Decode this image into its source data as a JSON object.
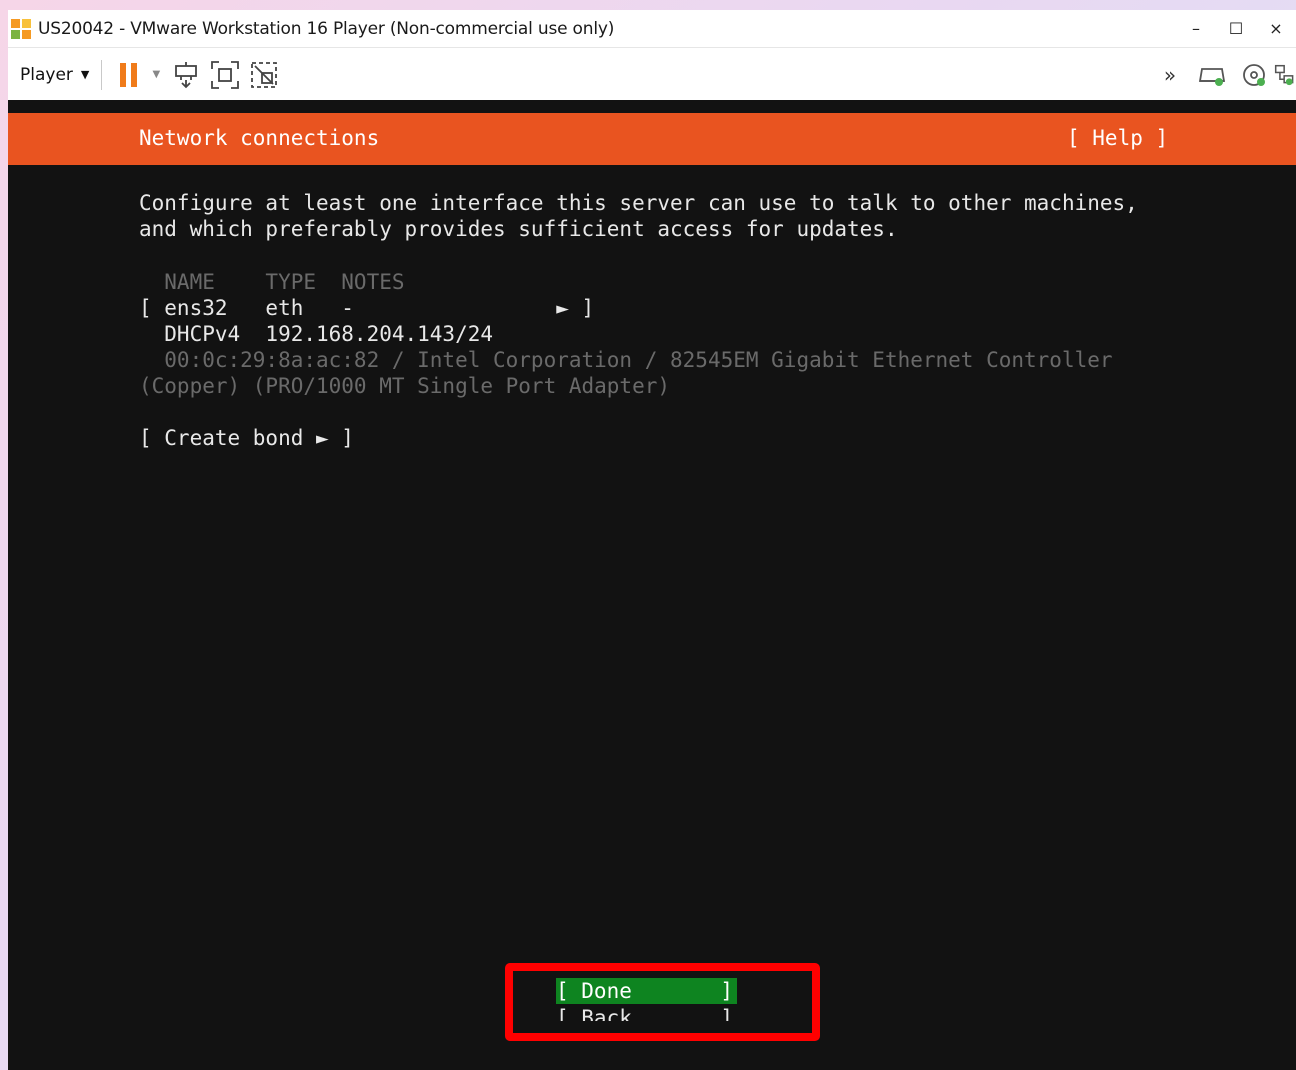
{
  "window": {
    "title": "US20042 - VMware Workstation 16 Player (Non-commercial use only)",
    "controls": {
      "minimize": "–",
      "maximize": "☐",
      "close": "×"
    }
  },
  "toolbar": {
    "player_menu": "Player",
    "icons": [
      "pause-icon",
      "dropdown-arrow-icon",
      "send-ctrl-alt-del-icon",
      "fullscreen-icon",
      "unity-icon",
      "more-icon",
      "removable-device-icon",
      "cd-dvd-icon",
      "network-adapter-icon"
    ]
  },
  "installer": {
    "header_title": "Network connections",
    "help": "[ Help ]",
    "description_line1": "Configure at least one interface this server can use to talk to other machines,",
    "description_line2": "and which preferably provides sufficient access for updates.",
    "table_header": "  NAME    TYPE  NOTES",
    "interface_row": "[ ens32   eth   -                ► ]",
    "dhcp_row": "  DHCPv4  192.168.204.143/24",
    "hw_line1": "  00:0c:29:8a:ac:82 / Intel Corporation / 82545EM Gigabit Ethernet Controller",
    "hw_line2": "(Copper) (PRO/1000 MT Single Port Adapter)",
    "create_bond": "[ Create bond ► ]",
    "done_button": "[ Done       ]",
    "back_button": "[ Back       ]"
  },
  "colors": {
    "header": "#e95420",
    "done_bg": "#0e8420",
    "highlight": "#ff0000",
    "screen_bg": "#121212"
  }
}
